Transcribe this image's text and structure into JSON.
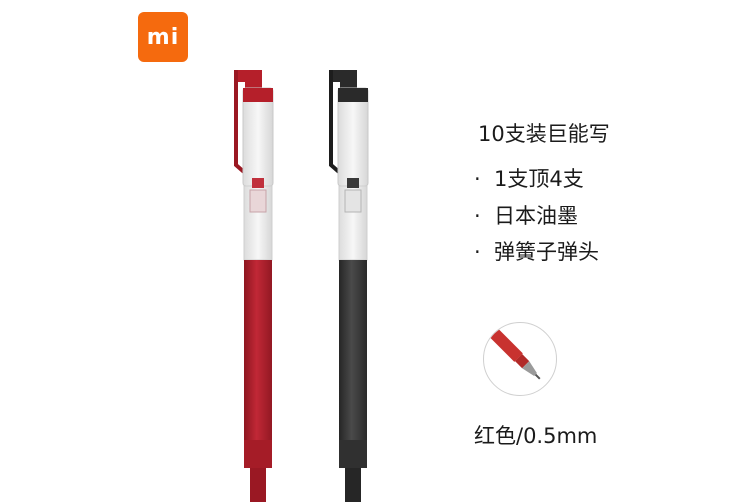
{
  "brand": {
    "logo_text": "mi",
    "logo_color": "#f56a0e"
  },
  "pens": [
    {
      "name": "red-pen",
      "ink_color": "#b51f2a",
      "clip_color": "#b51f2a"
    },
    {
      "name": "black-pen",
      "ink_color": "#3b3b3b",
      "clip_color": "#2a2a2a"
    }
  ],
  "headline": "10支装巨能写",
  "features": [
    {
      "bullet": "·",
      "text": "1支顶4支"
    },
    {
      "bullet": "·",
      "text": "日本油墨"
    },
    {
      "bullet": "·",
      "text": "弹簧子弹头"
    }
  ],
  "tip_detail": {
    "icon": "pen-tip-icon",
    "color": "#c8322f"
  },
  "caption": "红色/0.5mm"
}
